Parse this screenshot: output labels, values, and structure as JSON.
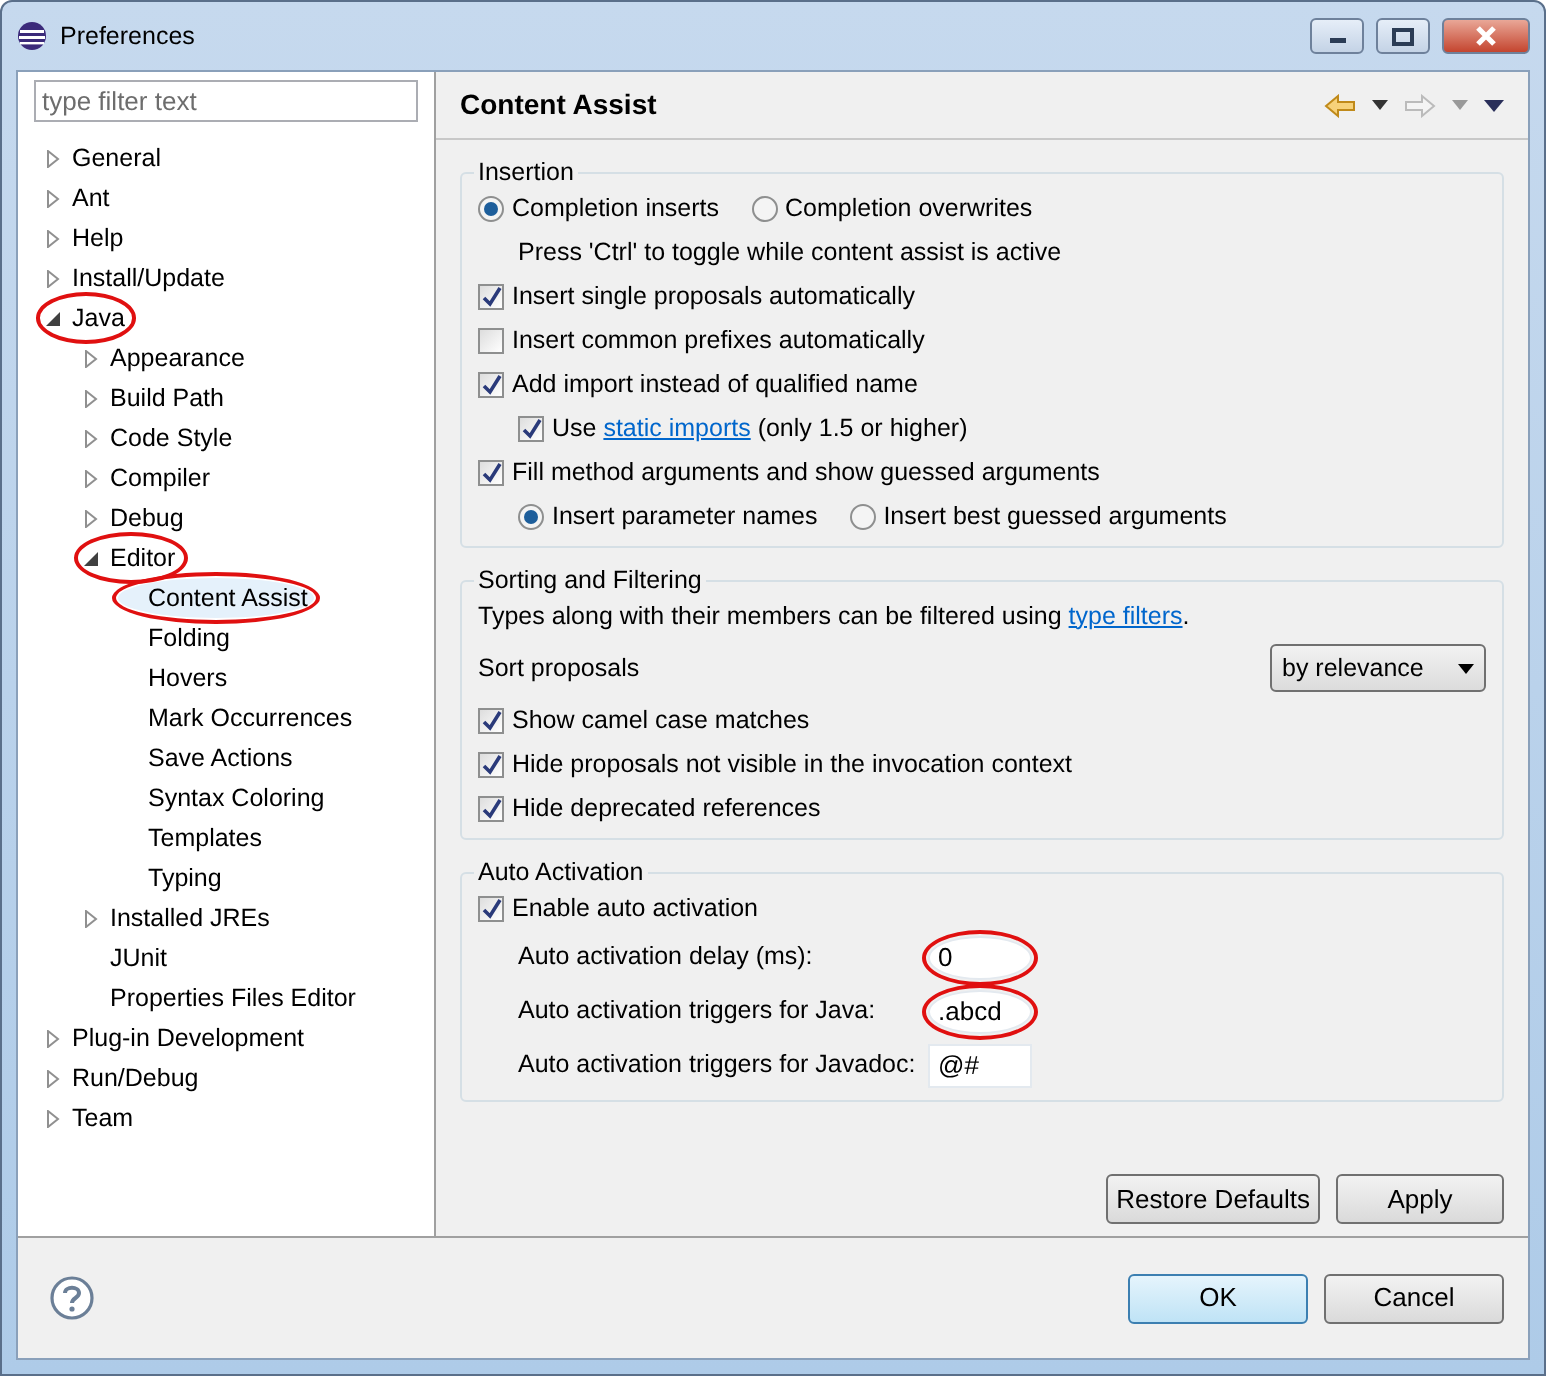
{
  "window": {
    "title": "Preferences"
  },
  "filter": {
    "placeholder": "type filter text"
  },
  "tree": [
    {
      "label": "General",
      "expanded": false
    },
    {
      "label": "Ant",
      "expanded": false
    },
    {
      "label": "Help",
      "expanded": false
    },
    {
      "label": "Install/Update",
      "expanded": false
    },
    {
      "label": "Java",
      "expanded": true,
      "circled": true,
      "children": [
        {
          "label": "Appearance",
          "expanded": false
        },
        {
          "label": "Build Path",
          "expanded": false
        },
        {
          "label": "Code Style",
          "expanded": false
        },
        {
          "label": "Compiler",
          "expanded": false
        },
        {
          "label": "Debug",
          "expanded": false
        },
        {
          "label": "Editor",
          "expanded": true,
          "circled": true,
          "children": [
            {
              "label": "Content Assist",
              "selected": true,
              "circled": true
            },
            {
              "label": "Folding",
              "selected": false
            },
            {
              "label": "Hovers",
              "selected": false
            },
            {
              "label": "Mark Occurrences",
              "selected": false
            },
            {
              "label": "Save Actions",
              "selected": false
            },
            {
              "label": "Syntax Coloring",
              "selected": false
            },
            {
              "label": "Templates",
              "selected": false
            },
            {
              "label": "Typing",
              "selected": false
            }
          ]
        },
        {
          "label": "Installed JREs",
          "expanded": false
        },
        {
          "label": "JUnit"
        },
        {
          "label": "Properties Files Editor"
        }
      ]
    },
    {
      "label": "Plug-in Development",
      "expanded": false
    },
    {
      "label": "Run/Debug",
      "expanded": false
    },
    {
      "label": "Team",
      "expanded": false
    }
  ],
  "page": {
    "title": "Content Assist"
  },
  "groups": [
    {
      "title": "Insertion",
      "rows": [
        {
          "kind": "radios",
          "options": [
            {
              "label": "Completion inserts",
              "selected": true
            },
            {
              "label": "Completion overwrites",
              "selected": false
            }
          ]
        },
        {
          "kind": "hint",
          "text": "Press 'Ctrl' to toggle while content assist is active"
        },
        {
          "kind": "checkbox",
          "label": "Insert single proposals automatically",
          "checked": true
        },
        {
          "kind": "checkbox",
          "label": "Insert common prefixes automatically",
          "checked": false
        },
        {
          "kind": "checkbox",
          "label": "Add import instead of qualified name",
          "checked": true,
          "children": [
            {
              "kind": "checkbox",
              "label": "Use ",
              "link": "static imports",
              "after": " (only 1.5 or higher)",
              "checked": true
            }
          ]
        },
        {
          "kind": "checkbox",
          "label": "Fill method arguments and show guessed arguments",
          "checked": true,
          "children": [
            {
              "kind": "radios",
              "options": [
                {
                  "label": "Insert parameter names",
                  "selected": true
                },
                {
                  "label": "Insert best guessed arguments",
                  "selected": false
                }
              ]
            }
          ]
        }
      ]
    },
    {
      "title": "Sorting and Filtering",
      "rows": [
        {
          "kind": "text",
          "text": "Types along with their members can be filtered using ",
          "link": "type filters",
          "after": "."
        },
        {
          "kind": "select",
          "label": "Sort proposals",
          "value": "by relevance"
        },
        {
          "kind": "checkbox",
          "label": "Show camel case matches",
          "checked": true
        },
        {
          "kind": "checkbox",
          "label": "Hide proposals not visible in the invocation context",
          "checked": true
        },
        {
          "kind": "checkbox",
          "label": "Hide deprecated references",
          "checked": true
        }
      ]
    },
    {
      "title": "Auto Activation",
      "rows": [
        {
          "kind": "checkbox",
          "label": "Enable auto activation",
          "checked": true
        },
        {
          "kind": "field",
          "label": "Auto activation delay (ms):",
          "value": "0",
          "circled": true
        },
        {
          "kind": "field",
          "label": "Auto activation triggers for Java:",
          "value": ".abcd",
          "circled": true
        },
        {
          "kind": "field",
          "label": "Auto activation triggers for Javadoc:",
          "value": "@#",
          "circled": false
        }
      ]
    }
  ],
  "page_buttons": [
    "Restore Defaults",
    "Apply"
  ],
  "dialog_buttons": [
    {
      "label": "OK",
      "default": true
    },
    {
      "label": "Cancel",
      "default": false
    }
  ]
}
